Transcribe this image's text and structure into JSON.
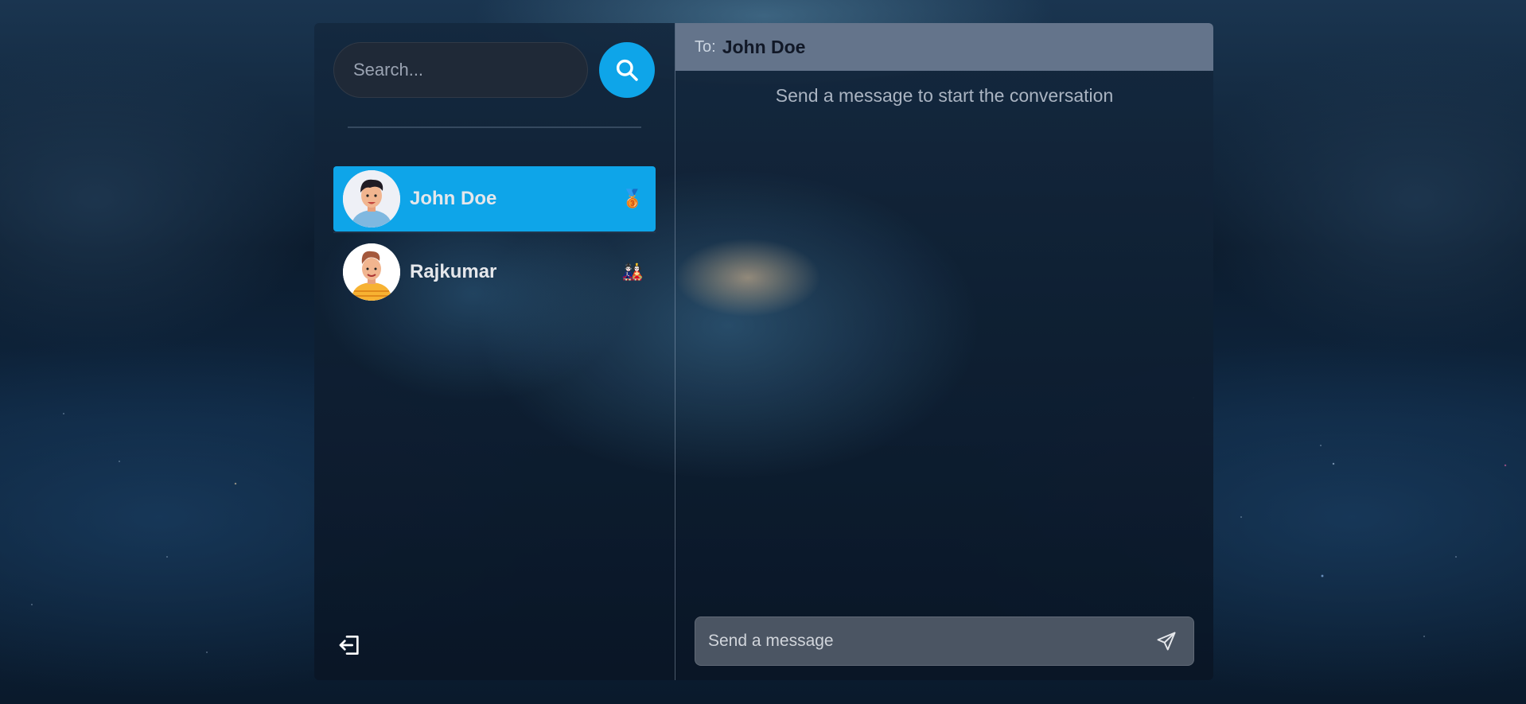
{
  "sidebar": {
    "search": {
      "placeholder": "Search...",
      "value": ""
    },
    "conversations": [
      {
        "name": "John Doe",
        "emoji": "🥉",
        "active": true
      },
      {
        "name": "Rajkumar",
        "emoji": "🎎",
        "active": false
      }
    ]
  },
  "chat": {
    "to_label": "To:",
    "recipient": "John Doe",
    "empty_text": "Send a message to start the conversation",
    "composer_placeholder": "Send a message"
  },
  "colors": {
    "accent": "#0ea5e9",
    "header": "#64748b",
    "composer": "#4b5563",
    "search_bg": "#1f2937"
  },
  "icons": {
    "search_button": "search-icon",
    "logout": "logout-icon",
    "send": "send-icon"
  }
}
